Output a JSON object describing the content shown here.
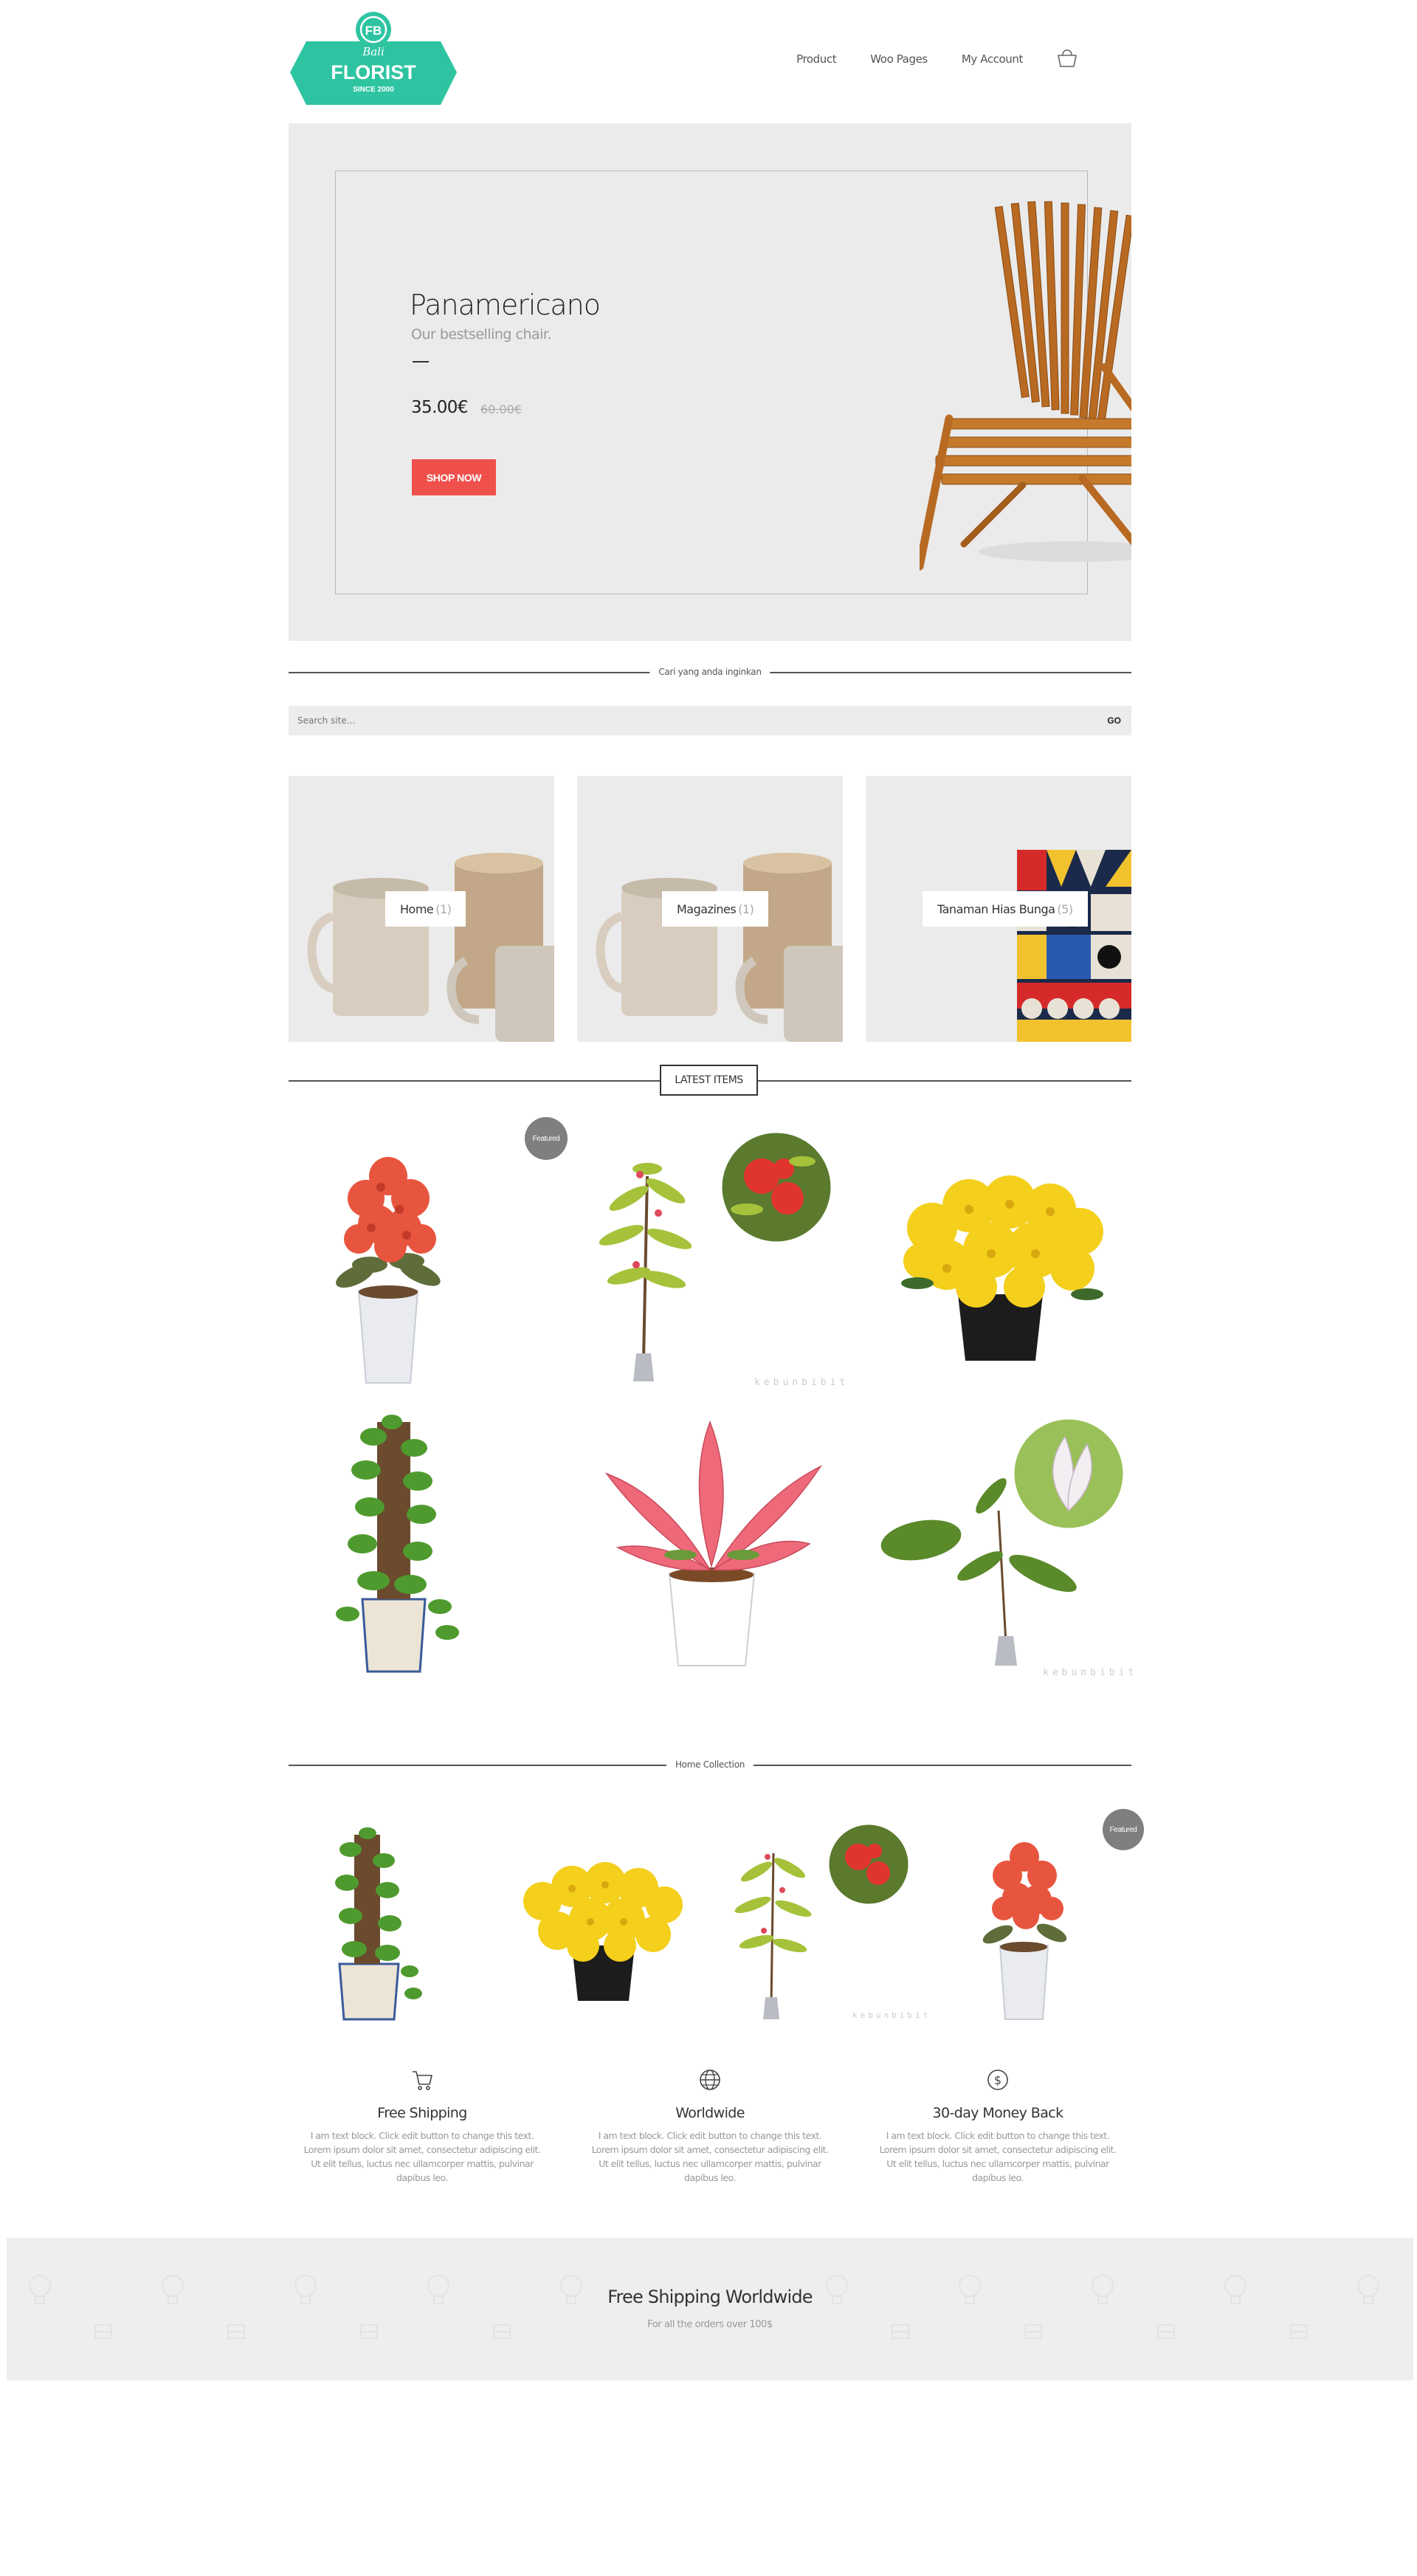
{
  "header": {
    "logo": {
      "monogram": "FB",
      "script": "Bali",
      "name": "FLORIST",
      "tagline": "SINCE 2000"
    },
    "nav": [
      "Product",
      "Woo Pages",
      "My Account"
    ]
  },
  "hero": {
    "title": "Panamericano",
    "subtitle": "Our bestselling chair.",
    "price": "35.00€",
    "old_price": "60.00€",
    "button": "SHOP NOW"
  },
  "search": {
    "section_label": "Cari yang anda inginkan",
    "placeholder": "Search site...",
    "button": "GO"
  },
  "categories": [
    {
      "name": "Home",
      "count": "(1)"
    },
    {
      "name": "Magazines",
      "count": "(1)"
    },
    {
      "name": "Tanaman Hias Bunga",
      "count": "(5)"
    }
  ],
  "latest": {
    "title": "LATEST ITEMS",
    "badge": "Featured",
    "watermark": "kebunbibit"
  },
  "home_collection": {
    "title": "Home Collection",
    "badge": "Featured",
    "watermark": "kebunbibit"
  },
  "features": [
    {
      "icon": "cart-icon",
      "title": "Free Shipping",
      "text": "I am text block. Click edit button to change this text. Lorem ipsum dolor sit amet, consectetur adipiscing elit. Ut elit tellus, luctus nec ullamcorper mattis, pulvinar dapibus leo."
    },
    {
      "icon": "globe-icon",
      "title": "Worldwide",
      "text": "I am text block. Click edit button to change this text. Lorem ipsum dolor sit amet, consectetur adipiscing elit. Ut elit tellus, luctus nec ullamcorper mattis, pulvinar dapibus leo."
    },
    {
      "icon": "dollar-icon",
      "title": "30-day Money Back",
      "text": "I am text block. Click edit button to change this text. Lorem ipsum dolor sit amet, consectetur adipiscing elit. Ut elit tellus, luctus nec ullamcorper mattis, pulvinar dapibus leo."
    }
  ],
  "banner": {
    "title": "Free Shipping Worldwide",
    "subtitle": "For all the orders over 100$"
  },
  "colors": {
    "logo_teal": "#2ec4a2",
    "shop_button": "#f0504c",
    "hero_bg": "#ebebeb",
    "badge": "#7f7f7f"
  }
}
